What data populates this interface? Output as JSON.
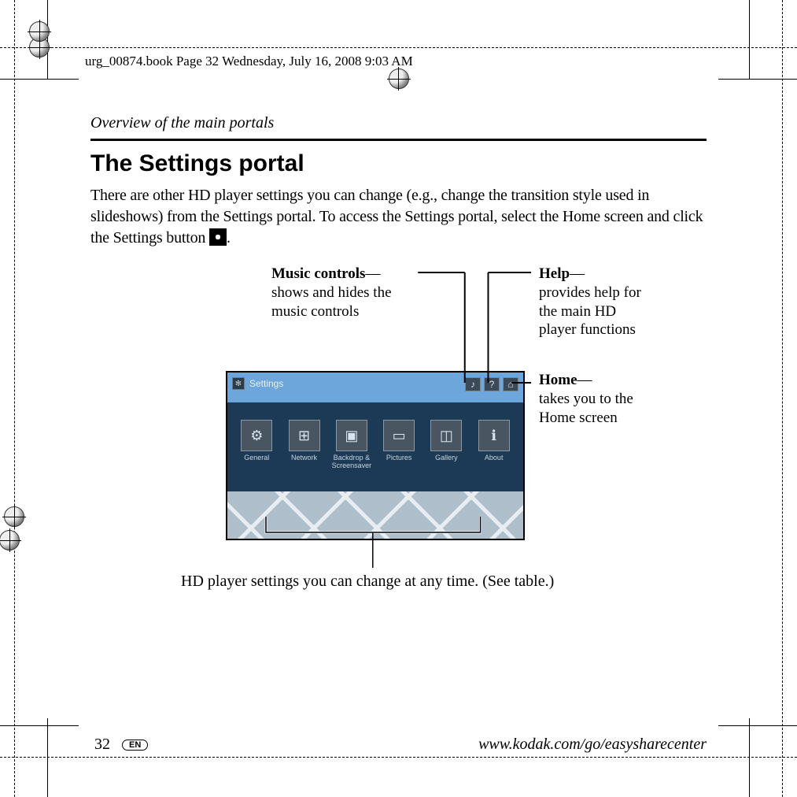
{
  "meta_header": "urg_00874.book  Page 32  Wednesday, July 16, 2008  9:03 AM",
  "section_label": "Overview of the main portals",
  "title": "The Settings portal",
  "paragraph_pre": "There are other HD player settings you can change (e.g., change the transition style used in slideshows) from the Settings portal. To access the Settings portal, select the Home screen and click the Settings button ",
  "paragraph_post": ".",
  "annotations": {
    "music": {
      "lead": "Music controls",
      "dash": "—",
      "rest": "shows and hides the music controls"
    },
    "help": {
      "lead": "Help",
      "dash": "—",
      "rest": "provides help for the main HD player functions"
    },
    "home": {
      "lead": "Home",
      "dash": "—",
      "rest": "takes you to the Home screen"
    },
    "bottom": "HD player settings you can change at any time. (See table.)"
  },
  "screenshot": {
    "title": "Settings",
    "top_icons": [
      "♪",
      "?",
      "⌂"
    ],
    "tiles": [
      {
        "glyph": "⚙",
        "label": "General"
      },
      {
        "glyph": "⊞",
        "label": "Network"
      },
      {
        "glyph": "▣",
        "label": "Backdrop & Screensaver"
      },
      {
        "glyph": "▭",
        "label": "Pictures"
      },
      {
        "glyph": "◫",
        "label": "Gallery"
      },
      {
        "glyph": "ℹ",
        "label": "About"
      }
    ]
  },
  "footer": {
    "page_number": "32",
    "lang_pill": "EN",
    "url": "www.kodak.com/go/easysharecenter"
  }
}
